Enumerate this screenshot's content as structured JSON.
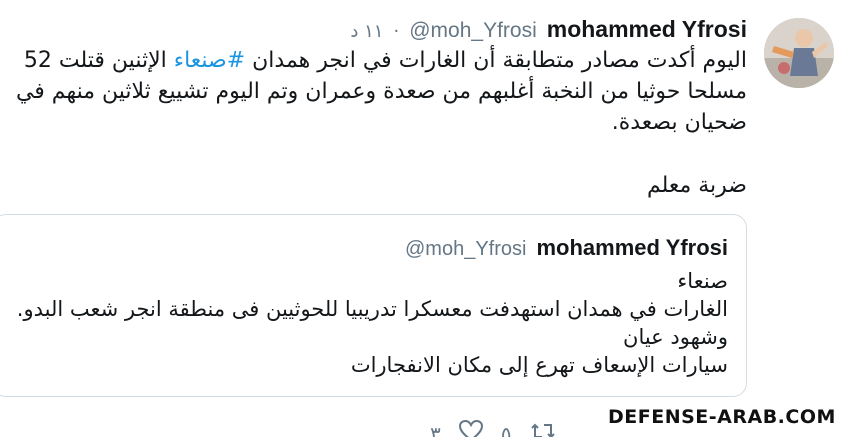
{
  "tweet": {
    "author_name": "mohammed Yfrosi",
    "handle": "@moh_Yfrosi",
    "separator": "·",
    "time": "١١ د",
    "text_parts": {
      "part1": "اليوم أكدت مصادر متطابقة أن الغارات في انجر همدان ",
      "hashtag": "#صنعاء",
      "part2": " الإثنين  قتلت 52 مسلحا حوثيا من النخبة أغلبهم من صعدة وعمران وتم اليوم تشييع ثلاثين منهم في ضحيان بصعدة."
    },
    "signoff": "ضربة معلم",
    "avatar_icon": "user-avatar-photo"
  },
  "quoted_tweet": {
    "author_name": "mohammed Yfrosi",
    "handle": "@moh_Yfrosi",
    "lines": [
      "صنعاء",
      "الغارات في همدان استهدفت معسكرا تدريبيا للحوثيين فى  منطقة انجر شعب البدو.",
      "وشهود عيان",
      "سيارات الإسعاف  تهرع إلى  مكان الانفجارات"
    ]
  },
  "actions": {
    "reply_count": "٣",
    "like_icon": "heart-icon",
    "retweet_count": "٥",
    "reply_icon": "reply-icon",
    "retweet_icon": "retweet-icon"
  },
  "watermark": "DEFENSE-ARAB.COM",
  "colors": {
    "text": "#14171a",
    "secondary": "#657786",
    "hashtag": "#1b95e0",
    "border": "#d4dce3"
  }
}
